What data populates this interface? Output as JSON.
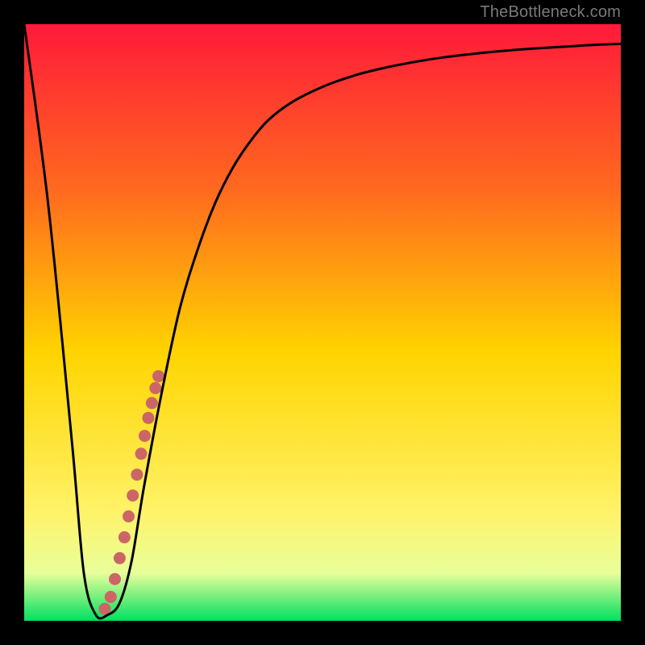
{
  "attribution": "TheBottleneck.com",
  "colors": {
    "frame": "#000000",
    "gradient_top": "#FF1A3A",
    "gradient_q1": "#FF6A1E",
    "gradient_mid": "#FFD400",
    "gradient_q3": "#FFF36A",
    "gradient_bottom_band": "#E8FF9A",
    "gradient_bottom": "#00E060",
    "curve": "#000000",
    "dots": "#CC6666"
  },
  "chart_data": {
    "type": "line",
    "title": "",
    "xlabel": "",
    "ylabel": "",
    "xlim": [
      0,
      100
    ],
    "ylim": [
      0,
      100
    ],
    "grid": false,
    "series": [
      {
        "name": "curve",
        "x": [
          0,
          4,
          8,
          10,
          12,
          14,
          16,
          18,
          20,
          23,
          26,
          29,
          32,
          35,
          38,
          41,
          45,
          50,
          55,
          60,
          65,
          70,
          75,
          80,
          85,
          90,
          95,
          100
        ],
        "y": [
          100,
          70,
          30,
          8,
          1,
          1,
          3,
          10,
          22,
          38,
          52,
          62,
          70,
          76,
          80.5,
          84,
          87,
          89.5,
          91.3,
          92.6,
          93.6,
          94.4,
          95,
          95.5,
          95.9,
          96.2,
          96.5,
          96.7
        ]
      }
    ],
    "scatter": {
      "name": "dots",
      "x": [
        13.5,
        14.5,
        15.2,
        16.0,
        16.8,
        17.5,
        18.2,
        18.9,
        19.6,
        20.2,
        20.8,
        21.4,
        22.0,
        22.5
      ],
      "y": [
        2.0,
        4.0,
        7.0,
        10.5,
        14.0,
        17.5,
        21.0,
        24.5,
        28.0,
        31.0,
        34.0,
        36.5,
        39.0,
        41.0
      ]
    }
  }
}
